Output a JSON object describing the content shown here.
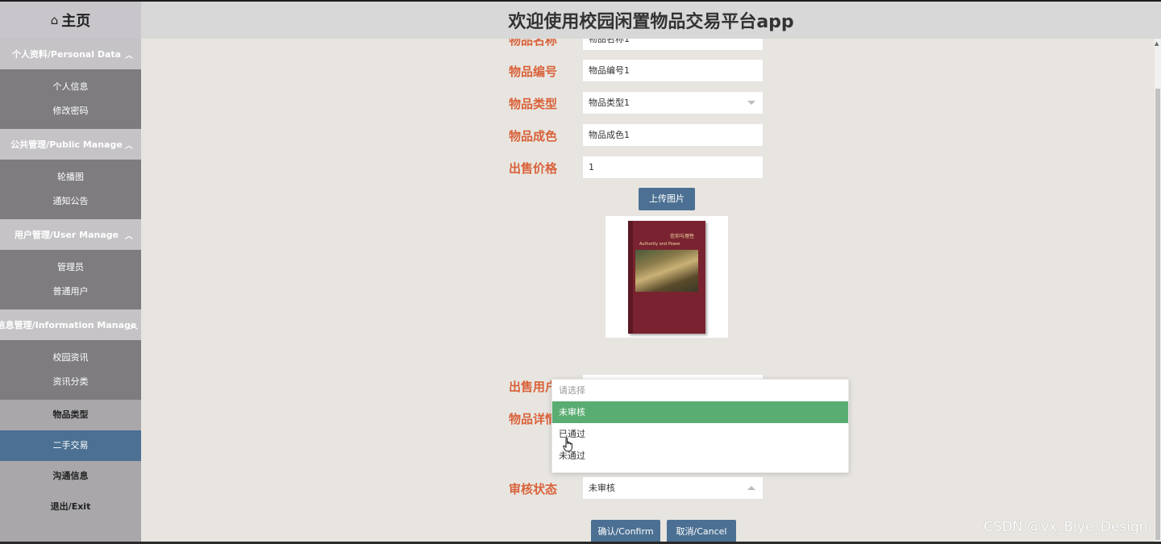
{
  "sidebar": {
    "home_label": "主页",
    "groups": [
      {
        "title": "个人资料/Personal Data",
        "items": [
          "个人信息",
          "修改密码"
        ]
      },
      {
        "title": "公共管理/Public Manage",
        "items": [
          "轮播图",
          "通知公告"
        ]
      },
      {
        "title": "用户管理/User Manage",
        "items": [
          "管理员",
          "普通用户"
        ]
      },
      {
        "title": "信息管理/Information Manage",
        "items": [
          "校园资讯",
          "资讯分类"
        ]
      }
    ],
    "items": [
      "物品类型",
      "二手交易",
      "沟通信息",
      "退出/Exit"
    ]
  },
  "header": {
    "title": "欢迎使用校园闲置物品交易平台app"
  },
  "form": {
    "name_label": "物品名称",
    "name_value": "物品名称1",
    "code_label": "物品编号",
    "code_value": "物品编号1",
    "type_label": "物品类型",
    "type_value": "物品类型1",
    "condition_label": "物品成色",
    "condition_value": "物品成色1",
    "price_label": "出售价格",
    "price_value": "1",
    "upload_label": "上传图片",
    "seller_label": "出售用户",
    "detail_label": "物品详情",
    "status_label": "审核状态",
    "status_value": "未审核",
    "confirm_label": "确认/Confirm",
    "cancel_label": "取消/Cancel"
  },
  "book": {
    "title": "信仰与理性",
    "subtitle": "Authority and Power"
  },
  "dropdown": {
    "placeholder": "请选择",
    "options": [
      "未审核",
      "已通过",
      "未通过"
    ],
    "selected": "未审核"
  },
  "watermark": "CSDN @vx_Biye_Design",
  "colors": {
    "accent": "#4b7093",
    "label": "#d9623a",
    "selected": "#5aad72"
  }
}
